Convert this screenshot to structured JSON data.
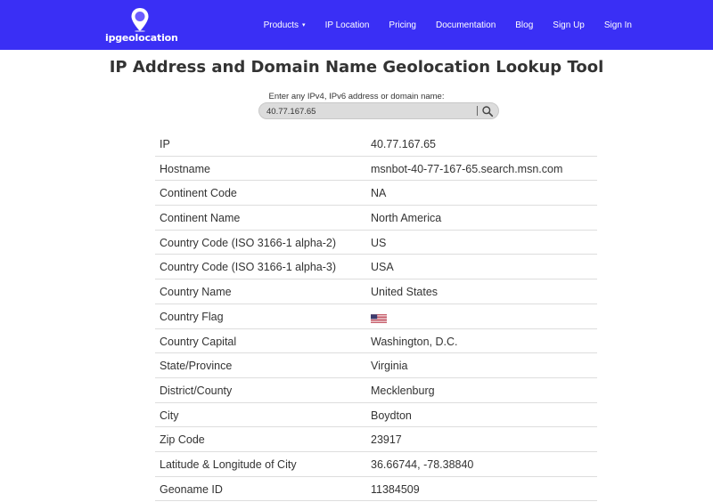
{
  "brand": {
    "name": "ipgeolocation"
  },
  "nav": {
    "items": [
      "Products",
      "IP Location",
      "Pricing",
      "Documentation",
      "Blog",
      "Sign Up",
      "Sign In"
    ],
    "caret": "▾"
  },
  "page": {
    "title": "IP Address and Domain Name Geolocation Lookup Tool",
    "prompt": "Enter any IPv4, IPv6 address or domain name:"
  },
  "search": {
    "value": "40.77.167.65",
    "icon": "search-icon"
  },
  "colors": {
    "navbar": "#3a2ff5",
    "text": "#333333",
    "divider": "#dddddd",
    "search_bg": "#dcdcdc"
  },
  "rows": [
    {
      "label": "IP",
      "value": "40.77.167.65"
    },
    {
      "label": "Hostname",
      "value": "msnbot-40-77-167-65.search.msn.com"
    },
    {
      "label": "Continent Code",
      "value": "NA"
    },
    {
      "label": "Continent Name",
      "value": "North America"
    },
    {
      "label": "Country Code (ISO 3166-1 alpha-2)",
      "value": "US"
    },
    {
      "label": "Country Code (ISO 3166-1 alpha-3)",
      "value": "USA"
    },
    {
      "label": "Country Name",
      "value": "United States"
    },
    {
      "label": "Country Flag",
      "value": ""
    },
    {
      "label": "Country Capital",
      "value": "Washington, D.C."
    },
    {
      "label": "State/Province",
      "value": "Virginia"
    },
    {
      "label": "District/County",
      "value": "Mecklenburg"
    },
    {
      "label": "City",
      "value": "Boydton"
    },
    {
      "label": "Zip Code",
      "value": "23917"
    },
    {
      "label": "Latitude & Longitude of City",
      "value": "36.66744, -78.38840"
    },
    {
      "label": "Geoname ID",
      "value": "11384509"
    }
  ]
}
